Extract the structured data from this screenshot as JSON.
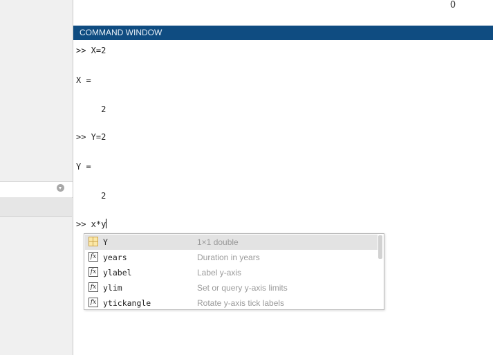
{
  "workspace": {
    "value": "0"
  },
  "command_window": {
    "title": "COMMAND WINDOW",
    "lines": [
      ">> X=2",
      "X =",
      "     2",
      ">> Y=2",
      "Y =",
      "     2"
    ],
    "current_input": ">> x*y"
  },
  "autocomplete": {
    "items": [
      {
        "icon": "variable-icon",
        "name": "Y",
        "description": "1×1 double"
      },
      {
        "icon": "function-icon",
        "name": "years",
        "description": "Duration in years"
      },
      {
        "icon": "function-icon",
        "name": "ylabel",
        "description": "Label y-axis"
      },
      {
        "icon": "function-icon",
        "name": "ylim",
        "description": "Set or query y-axis limits"
      },
      {
        "icon": "function-icon",
        "name": "ytickangle",
        "description": "Rotate y-axis tick labels"
      }
    ]
  },
  "colors": {
    "header_bg": "#0f4c81",
    "header_text": "#e8f0f8",
    "selection_bg": "#e3e3e3"
  }
}
